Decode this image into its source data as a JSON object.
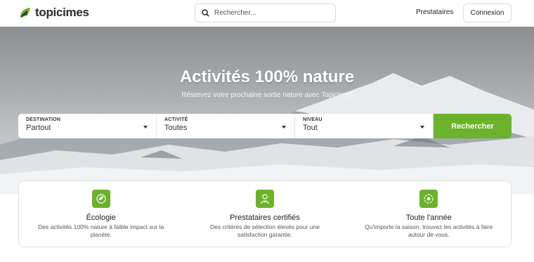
{
  "header": {
    "brand": "topicimes",
    "search_placeholder": "Rechercher...",
    "nav_providers": "Prestataires",
    "login_label": "Connexion"
  },
  "hero": {
    "title": "Activités 100% nature",
    "subtitle": "Réservez votre prochaine sortie nature avec Topicimes"
  },
  "filters": [
    {
      "label": "DESTINATION",
      "value": "Partout"
    },
    {
      "label": "ACTIVITÉ",
      "value": "Toutes"
    },
    {
      "label": "NIVEAU",
      "value": "Tout"
    }
  ],
  "search_button": "Rechercher",
  "features": [
    {
      "icon": "ecology-icon",
      "title": "Écologie",
      "desc": "Des activités 100% nature à faible impact sur la planète."
    },
    {
      "icon": "certified-provider-icon",
      "title": "Prestataires certifiés",
      "desc": "Des critères de sélection élevés pour une satisfaction garantie."
    },
    {
      "icon": "year-round-icon",
      "title": "Toute l'année",
      "desc": "Qu'importe la saison, trouvez les activités à faire autour de vous."
    }
  ],
  "colors": {
    "accent": "#6db22b",
    "text": "#222222"
  }
}
